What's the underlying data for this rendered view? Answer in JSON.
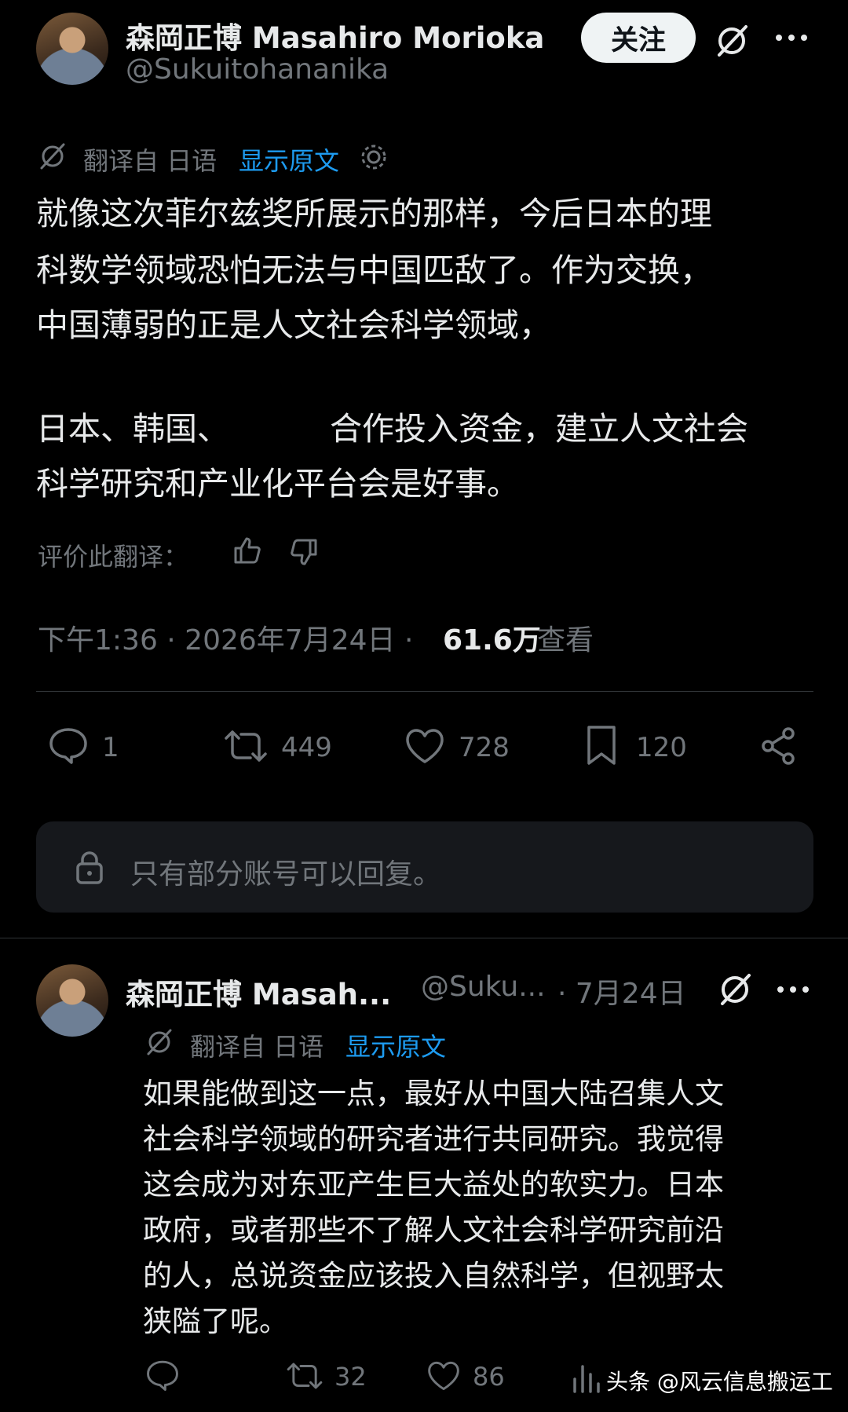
{
  "main_tweet": {
    "author_name": "森岡正博 Masahiro Morioka",
    "handle": "@Sukuitohananika",
    "follow_label": "关注",
    "translated_from": "翻译自 日语",
    "show_original": "显示原文",
    "text_lines": [
      "就像这次菲尔兹奖所展示的那样，今后日本的理",
      "科数学领域恐怕无法与中国匹敌了。作为交换，",
      "中国薄弱的正是人文社会科学领域，",
      "",
      "日本、韩国、",
      "合作投入资金，建立人文社会",
      "科学研究和产业化平台会是好事。"
    ],
    "rate_translation": "评价此翻译：",
    "timestamp": "下午1:36 · 2026年7月24日 ·",
    "views_count": "61.6万",
    "views_label": "查看",
    "actions": {
      "reply_count": "1",
      "retweet_count": "449",
      "like_count": "728",
      "bookmark_count": "120"
    },
    "reply_restriction": "只有部分账号可以回复。"
  },
  "reply_tweet": {
    "author_name": "森岡正博 Masah...",
    "handle": "@Suku...",
    "date": "· 7月24日",
    "translated_from": "翻译自 日语",
    "show_original": "显示原文",
    "text_lines": [
      "如果能做到这一点，最好从中国大陆召集人文",
      "社会科学领域的研究者进行共同研究。我觉得",
      "这会成为对东亚产生巨大益处的软实力。日本",
      "政府，或者那些不了解人文社会科学研究前沿",
      "的人，总说资金应该投入自然科学，但视野太",
      "狭隘了呢。"
    ],
    "actions": {
      "retweet_count": "32",
      "like_count": "86"
    }
  },
  "watermark": "头条 @风云信息搬运工",
  "colors": {
    "background": "#000000",
    "text": "#e7e9ea",
    "muted": "#71767b",
    "link": "#1d9bf0",
    "divider": "#2f3336"
  }
}
